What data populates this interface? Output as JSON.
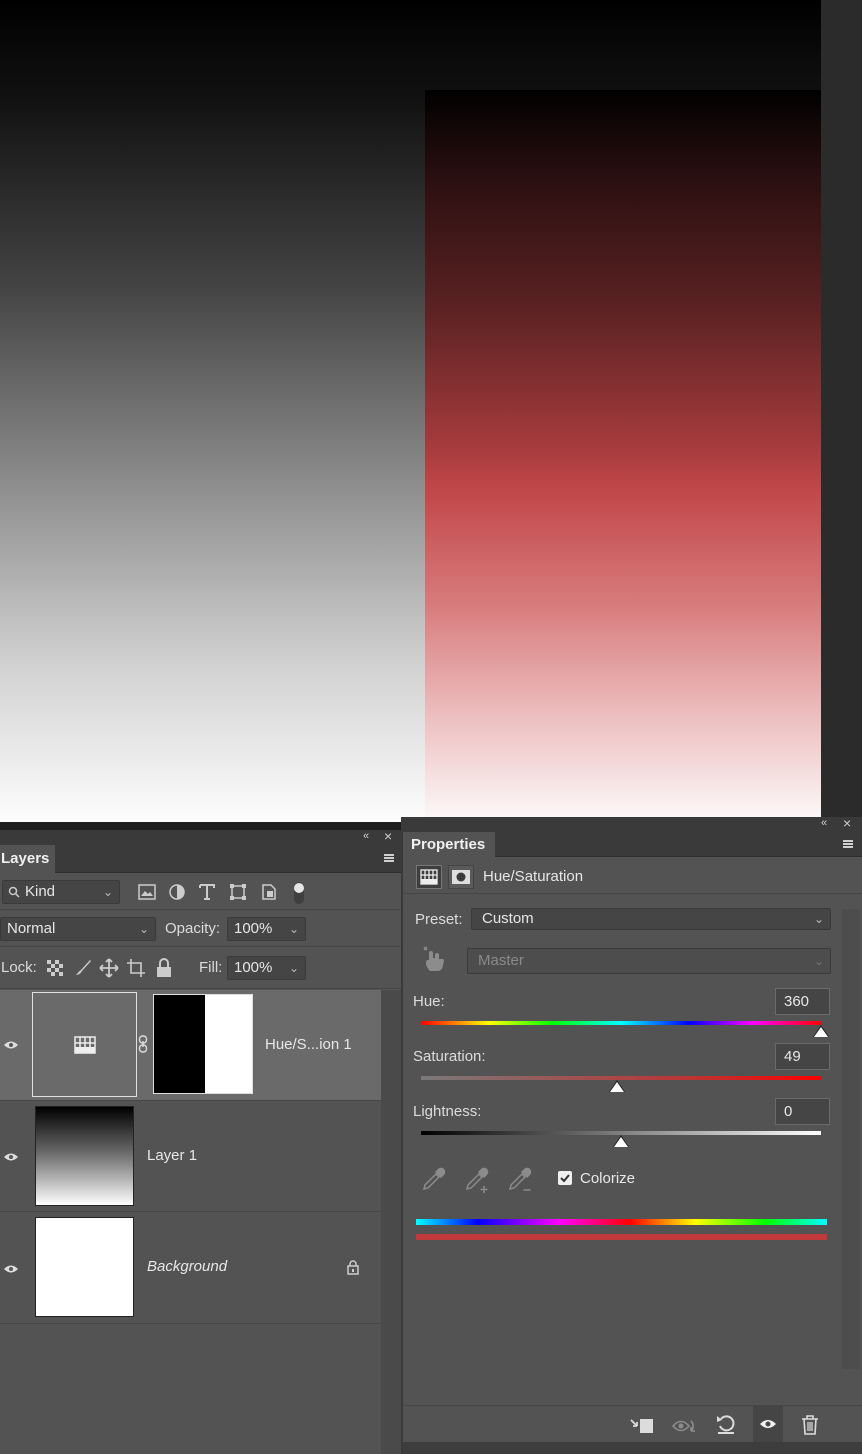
{
  "layers_panel": {
    "tab_label": "Layers",
    "filter": {
      "kind_label": "Kind",
      "icons": [
        "image-filter-icon",
        "adjustment-filter-icon",
        "type-filter-icon",
        "shape-filter-icon",
        "smart-object-filter-icon",
        "filter-toggle-icon"
      ]
    },
    "blend_mode": "Normal",
    "opacity_label": "Opacity:",
    "opacity_value": "100%",
    "lock_label": "Lock:",
    "fill_label": "Fill:",
    "fill_value": "100%",
    "layers": [
      {
        "name": "Hue/S...ion 1",
        "visible": true,
        "selected": true,
        "type": "adjustment"
      },
      {
        "name": "Layer 1",
        "visible": true,
        "selected": false,
        "type": "gradient"
      },
      {
        "name": "Background",
        "visible": true,
        "selected": false,
        "type": "background",
        "locked": true
      }
    ]
  },
  "properties_panel": {
    "tab_label": "Properties",
    "adjustment_title": "Hue/Saturation",
    "preset_label": "Preset:",
    "preset_value": "Custom",
    "channel_value": "Master",
    "hue_label": "Hue:",
    "hue_value": "360",
    "saturation_label": "Saturation:",
    "saturation_value": "49",
    "lightness_label": "Lightness:",
    "lightness_value": "0",
    "colorize_label": "Colorize",
    "colorize_checked": true,
    "slider_levels": {
      "hue": 1.0,
      "saturation": 0.49,
      "lightness": 0.5
    },
    "bottom_icons": [
      "clip-to-layer-icon",
      "view-previous-state-icon",
      "reset-icon",
      "visibility-icon",
      "delete-icon"
    ]
  },
  "colors": {
    "panel": "#535353",
    "canvas_tint": "#c2484a"
  }
}
